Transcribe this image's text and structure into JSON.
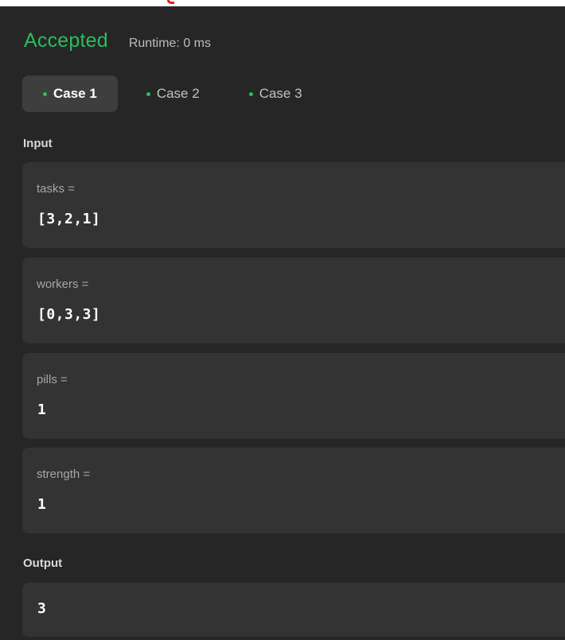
{
  "result": {
    "status": "Accepted",
    "runtime": "Runtime: 0 ms"
  },
  "tabs": [
    {
      "label": "Case 1"
    },
    {
      "label": "Case 2"
    },
    {
      "label": "Case 3"
    }
  ],
  "input": {
    "label": "Input",
    "fields": [
      {
        "name": "tasks =",
        "value": "[3,2,1]"
      },
      {
        "name": "workers =",
        "value": "[0,3,3]"
      },
      {
        "name": "pills =",
        "value": "1"
      },
      {
        "name": "strength =",
        "value": "1"
      }
    ]
  },
  "output": {
    "label": "Output",
    "value": "3"
  },
  "colors": {
    "accepted": "#2cbb5d",
    "panel_bg": "#262626",
    "field_bg": "#333333",
    "active_tab_bg": "#3e3e3e"
  }
}
